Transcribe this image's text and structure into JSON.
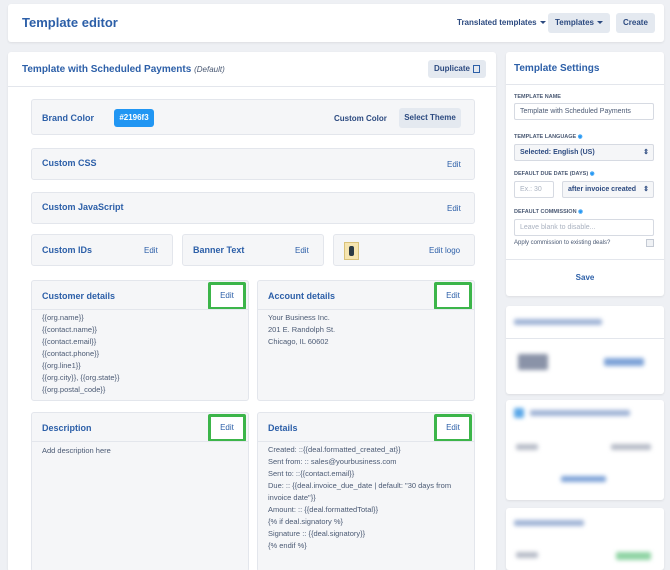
{
  "header": {
    "title": "Template editor",
    "translated_label": "Translated templates",
    "templates_label": "Templates",
    "create_label": "Create"
  },
  "main": {
    "title": "Template with Scheduled Payments",
    "default_tag": "(Default)",
    "duplicate_label": "Duplicate",
    "brand": {
      "label": "Brand Color",
      "color": "#2196f3",
      "color_text": "#2196f3",
      "custom_color_label": "Custom Color",
      "select_theme_label": "Select Theme"
    },
    "custom_css": {
      "label": "Custom CSS",
      "edit": "Edit"
    },
    "custom_js": {
      "label": "Custom JavaScript",
      "edit": "Edit"
    },
    "custom_ids": {
      "label": "Custom IDs",
      "edit": "Edit"
    },
    "banner_text": {
      "label": "Banner Text",
      "edit": "Edit"
    },
    "logo": {
      "edit": "Edit logo"
    },
    "customer_details": {
      "label": "Customer details",
      "edit": "Edit",
      "lines": [
        "{{org.name}}",
        "{{contact.name}}",
        "{{contact.email}}",
        "{{contact.phone}}",
        "{{org.line1}}",
        "{{org.city}}, {{org.state}}",
        "{{org.postal_code}}"
      ]
    },
    "account_details": {
      "label": "Account details",
      "edit": "Edit",
      "lines": [
        "Your Business Inc.",
        "201 E. Randolph St.",
        "Chicago, IL 60602"
      ]
    },
    "description": {
      "label": "Description",
      "edit": "Edit",
      "text": "Add description here"
    },
    "details": {
      "label": "Details",
      "edit": "Edit",
      "lines": [
        "Created: ::{{deal.formatted_created_at}}",
        "Sent from: :: sales@yourbusiness.com",
        "Sent to: ::{{contact.email}}",
        "Due: :: {{deal.invoice_due_date | default: \"30 days from",
        "invoice date\"}}",
        "Amount: :: {{deal.formattedTotal}}",
        "{% if deal.signatory %}",
        "Signature :: {{deal.signatory}}",
        "{% endif %}"
      ]
    }
  },
  "settings": {
    "title": "Template Settings",
    "name_label": "TEMPLATE NAME",
    "name_value": "Template with Scheduled Payments",
    "language_label": "TEMPLATE LANGUAGE",
    "language_value": "Selected: English (US)",
    "due_label": "DEFAULT DUE DATE (DAYS)",
    "due_placeholder": "Ex.: 30",
    "due_select": "after invoice created",
    "commission_label": "DEFAULT COMMISSION",
    "commission_placeholder": "Leave blank to disable...",
    "apply_label": "Apply commission to existing deals?",
    "save_label": "Save"
  }
}
